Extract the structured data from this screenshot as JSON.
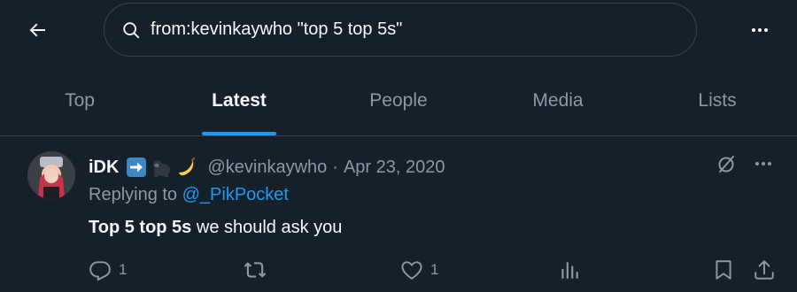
{
  "header": {
    "search_query": "from:kevinkaywho \"top 5 top 5s\""
  },
  "tabs": [
    {
      "label": "Top",
      "active": false
    },
    {
      "label": "Latest",
      "active": true
    },
    {
      "label": "People",
      "active": false
    },
    {
      "label": "Media",
      "active": false
    },
    {
      "label": "Lists",
      "active": false
    }
  ],
  "tweet": {
    "display_name": "iDK",
    "name_emoji_icons": [
      "right-arrow-icon",
      "gorilla-icon",
      "banana-icon"
    ],
    "handle": "@kevinkaywho",
    "separator": "·",
    "date": "Apr 23, 2020",
    "replying_prefix": "Replying to",
    "replying_to": "@_PikPocket",
    "text_bold": "Top 5 top 5s",
    "text_rest": " we should ask you",
    "reply_count": "1",
    "retweet_count": "",
    "like_count": "1"
  },
  "colors": {
    "background": "#15202b",
    "accent": "#1d9bf0",
    "muted": "#8b98a5",
    "text": "#f7f9f9",
    "border": "#38444d"
  }
}
